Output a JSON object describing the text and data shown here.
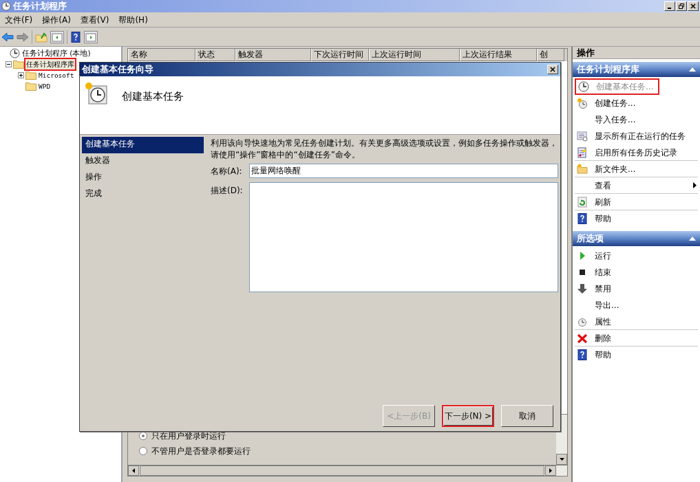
{
  "window": {
    "title": "任务计划程序"
  },
  "menu": [
    {
      "label": "文件(F)"
    },
    {
      "label": "操作(A)"
    },
    {
      "label": "查看(V)"
    },
    {
      "label": "帮助(H)"
    }
  ],
  "tree": [
    {
      "label": "任务计划程序 (本地)",
      "selected": false,
      "highlighted": false,
      "children": [
        {
          "label": "任务计划程序库",
          "selected": true,
          "highlighted": true,
          "expanded": true,
          "children": [
            {
              "label": "Microsoft",
              "selected": false,
              "highlighted": false,
              "expanded": false
            },
            {
              "label": "WPD",
              "selected": false,
              "highlighted": false
            }
          ]
        }
      ]
    }
  ],
  "table": {
    "columns": [
      "名称",
      "状态",
      "触发器",
      "下次运行时间",
      "上次运行时间",
      "上次运行结果",
      "创"
    ]
  },
  "background_options": [
    {
      "label": "只在用户登录时运行",
      "selected": true
    },
    {
      "label": "不管用户是否登录都要运行",
      "selected": false
    }
  ],
  "dialog": {
    "title": "创建基本任务向导",
    "heading": "创建基本任务",
    "steps": [
      {
        "label": "创建基本任务",
        "selected": true
      },
      {
        "label": "触发器",
        "selected": false
      },
      {
        "label": "操作",
        "selected": false
      },
      {
        "label": "完成",
        "selected": false
      }
    ],
    "intro": "利用该向导快速地为常见任务创建计划。有关更多高级选项或设置，例如多任务操作或触发器，请使用“操作”窗格中的“创建任务”命令。",
    "name_field": {
      "label": "名称(A):",
      "value": "批量网络唤醒"
    },
    "description_field": {
      "label": "描述(D):"
    },
    "buttons": [
      {
        "label": "<上一步(B)",
        "disabled": true,
        "highlighted": false
      },
      {
        "label": "下一步(N) >",
        "disabled": false,
        "highlighted": true
      },
      {
        "label": "取消",
        "disabled": false,
        "highlighted": false
      }
    ]
  },
  "actions": {
    "title": "操作",
    "sections": [
      {
        "title": "任务计划程序库",
        "items": [
          {
            "label": "创建基本任务...",
            "kind": "clock",
            "disabled": true,
            "highlighted": true,
            "divider_after": false,
            "submenu": false
          },
          {
            "label": "创建任务...",
            "kind": "clock-star",
            "disabled": false,
            "highlighted": false,
            "divider_after": false,
            "submenu": false
          },
          {
            "label": "导入任务...",
            "kind": "none",
            "disabled": false,
            "highlighted": false,
            "divider_after": false,
            "submenu": false
          },
          {
            "label": "显示所有正在运行的任务",
            "kind": "list",
            "disabled": false,
            "highlighted": false,
            "divider_after": false,
            "submenu": false
          },
          {
            "label": "启用所有任务历史记录",
            "kind": "log",
            "disabled": false,
            "highlighted": false,
            "divider_after": true,
            "submenu": false
          },
          {
            "label": "新文件夹...",
            "kind": "folder",
            "disabled": false,
            "highlighted": false,
            "divider_after": true,
            "submenu": false
          },
          {
            "label": "查看",
            "kind": "none",
            "disabled": false,
            "highlighted": false,
            "divider_after": true,
            "submenu": true
          },
          {
            "label": "刷新",
            "kind": "refresh",
            "disabled": false,
            "highlighted": false,
            "divider_after": true,
            "submenu": false
          },
          {
            "label": "帮助",
            "kind": "help",
            "disabled": false,
            "highlighted": false,
            "divider_after": false,
            "submenu": false
          }
        ]
      },
      {
        "title": "所选项",
        "items": [
          {
            "label": "运行",
            "kind": "run",
            "disabled": false,
            "highlighted": false,
            "divider_after": false,
            "submenu": false
          },
          {
            "label": "结束",
            "kind": "stop",
            "disabled": false,
            "highlighted": false,
            "divider_after": false,
            "submenu": false
          },
          {
            "label": "禁用",
            "kind": "down",
            "disabled": false,
            "highlighted": false,
            "divider_after": false,
            "submenu": false
          },
          {
            "label": "导出...",
            "kind": "none",
            "disabled": false,
            "highlighted": false,
            "divider_after": false,
            "submenu": false
          },
          {
            "label": "属性",
            "kind": "clock-small",
            "disabled": false,
            "highlighted": false,
            "divider_after": true,
            "submenu": false
          },
          {
            "label": "删除",
            "kind": "delete",
            "disabled": false,
            "highlighted": false,
            "divider_after": true,
            "submenu": false
          },
          {
            "label": "帮助",
            "kind": "help",
            "disabled": false,
            "highlighted": false,
            "divider_after": false,
            "submenu": false
          }
        ]
      }
    ]
  }
}
